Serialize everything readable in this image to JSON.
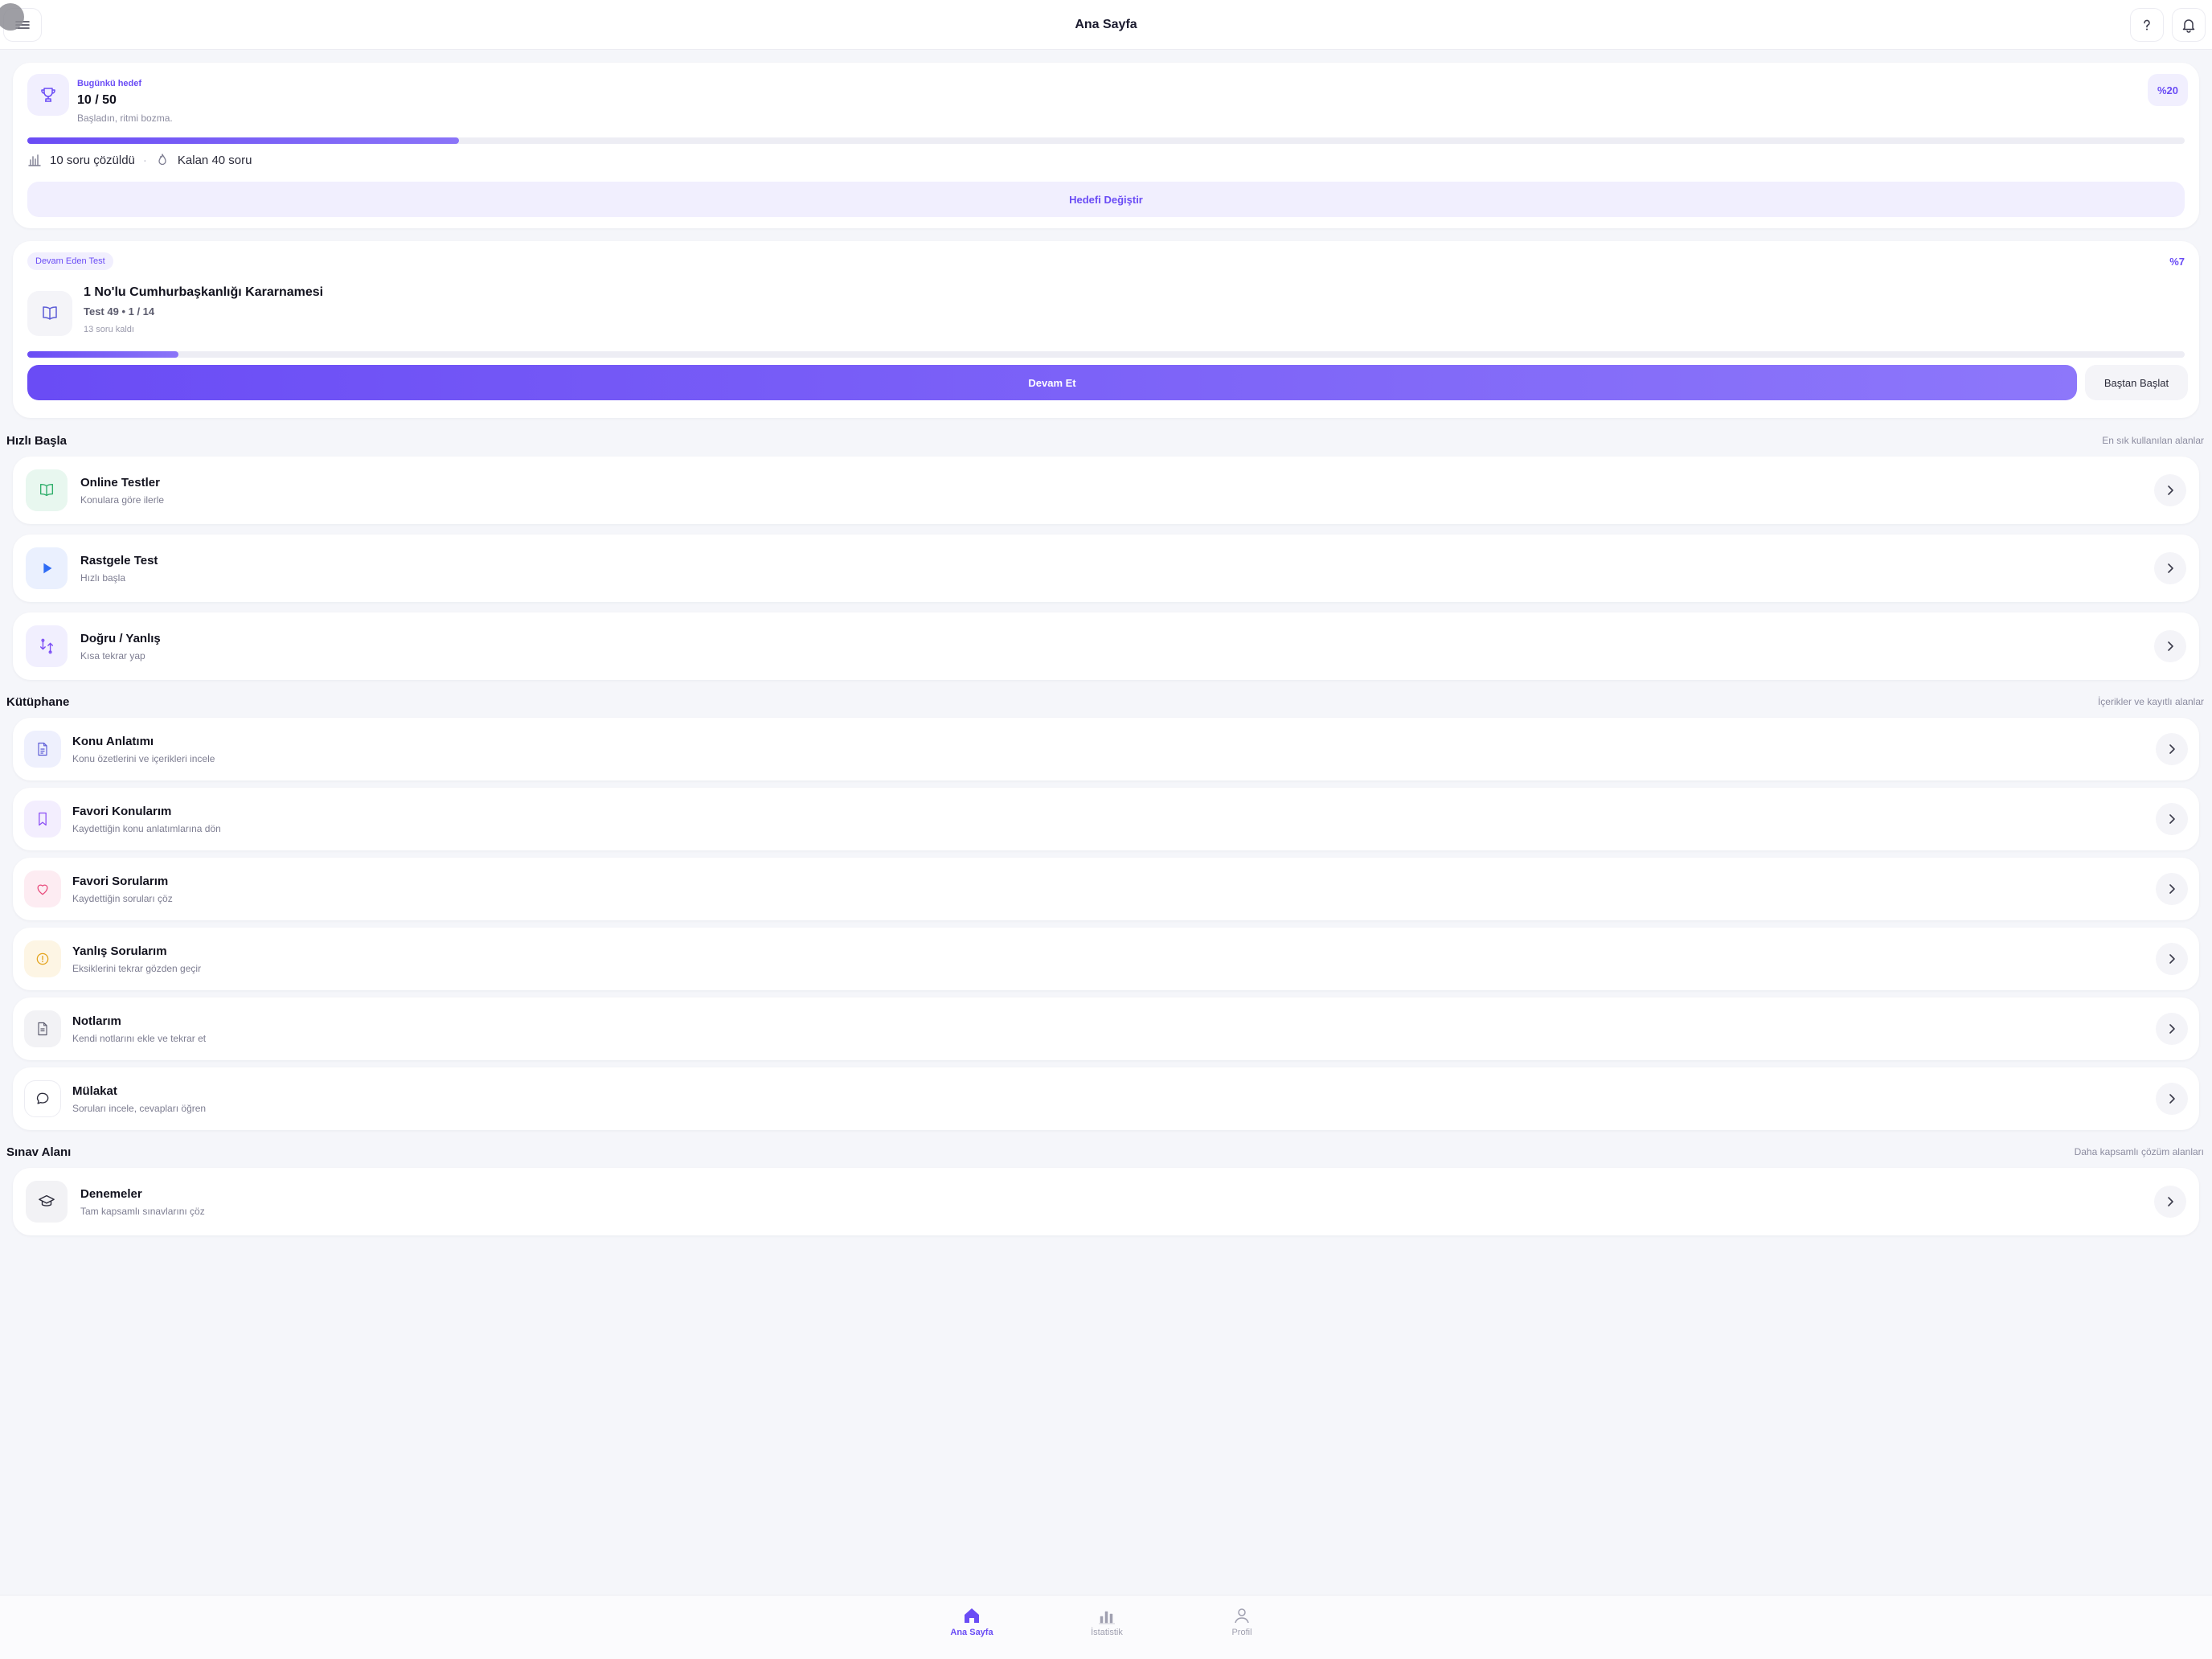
{
  "header": {
    "title": "Ana Sayfa"
  },
  "goal": {
    "label": "Bugünkü hedef",
    "value": "10 / 50",
    "subtitle": "Başladın, ritmi bozma.",
    "percent_label": "%20",
    "progress": 0.2,
    "solved_text": "10 soru çözüldü",
    "separator": "·",
    "remaining_text": "Kalan 40 soru",
    "change_button": "Hedefi Değiştir"
  },
  "ongoing": {
    "pill": "Devam Eden Test",
    "percent_label": "%7",
    "title": "1 No'lu Cumhurbaşkanlığı Kararnamesi",
    "meta": "Test 49 • 1 / 14",
    "left_text": "13 soru kaldı",
    "progress": 0.07,
    "continue_button": "Devam Et",
    "restart_button": "Baştan Başlat"
  },
  "quick": {
    "title": "Hızlı Başla",
    "subtitle": "En sık kullanılan alanlar",
    "items": [
      {
        "title": "Online Testler",
        "subtitle": "Konulara göre ilerle",
        "icon": "book-open-icon",
        "color": "#2fae6a",
        "bg": "#e8f7ef"
      },
      {
        "title": "Rastgele Test",
        "subtitle": "Hızlı başla",
        "icon": "play-icon",
        "color": "#2f6cf5",
        "bg": "#eaf0fe"
      },
      {
        "title": "Doğru / Yanlış",
        "subtitle": "Kısa tekrar yap",
        "icon": "swap-icon",
        "color": "#7a4cf5",
        "bg": "#f1effe"
      }
    ]
  },
  "library": {
    "title": "Kütüphane",
    "subtitle": "İçerikler ve kayıtlı alanlar",
    "items": [
      {
        "title": "Konu Anlatımı",
        "subtitle": "Konu özetlerini ve içerikleri incele",
        "icon": "document-icon",
        "color": "#5b5bd6",
        "bg": "#eef0fd"
      },
      {
        "title": "Favori Konularım",
        "subtitle": "Kaydettiğin konu anlatımlarına dön",
        "icon": "bookmark-icon",
        "color": "#8a4cf5",
        "bg": "#f3eefe"
      },
      {
        "title": "Favori Sorularım",
        "subtitle": "Kaydettiğin soruları çöz",
        "icon": "heart-icon",
        "color": "#e8487a",
        "bg": "#fdecf2"
      },
      {
        "title": "Yanlış Sorularım",
        "subtitle": "Eksiklerini tekrar gözden geçir",
        "icon": "alert-icon",
        "color": "#e3a21a",
        "bg": "#fdf5e4"
      },
      {
        "title": "Notlarım",
        "subtitle": "Kendi notlarını ekle ve tekrar et",
        "icon": "note-icon",
        "color": "#5c5c6e",
        "bg": "#f2f2f5"
      },
      {
        "title": "Mülakat",
        "subtitle": "Soruları incele, cevapları öğren",
        "icon": "chat-icon",
        "color": "#2b2b3a",
        "bg": "#ffffff"
      }
    ]
  },
  "exam": {
    "title": "Sınav Alanı",
    "subtitle": "Daha kapsamlı çözüm alanları",
    "items": [
      {
        "title": "Denemeler",
        "subtitle": "Tam kapsamlı sınavlarını çöz",
        "icon": "graduation-cap-icon",
        "color": "#2b2b3a",
        "bg": "#f2f2f5"
      }
    ]
  },
  "nav": {
    "items": [
      {
        "label": "Ana Sayfa",
        "icon": "home-icon",
        "active": true
      },
      {
        "label": "İstatistik",
        "icon": "bar-chart-icon",
        "active": false
      },
      {
        "label": "Profil",
        "icon": "user-icon",
        "active": false
      }
    ]
  },
  "colors": {
    "accent": "#6a4cf5",
    "background": "#f5f6fa"
  }
}
